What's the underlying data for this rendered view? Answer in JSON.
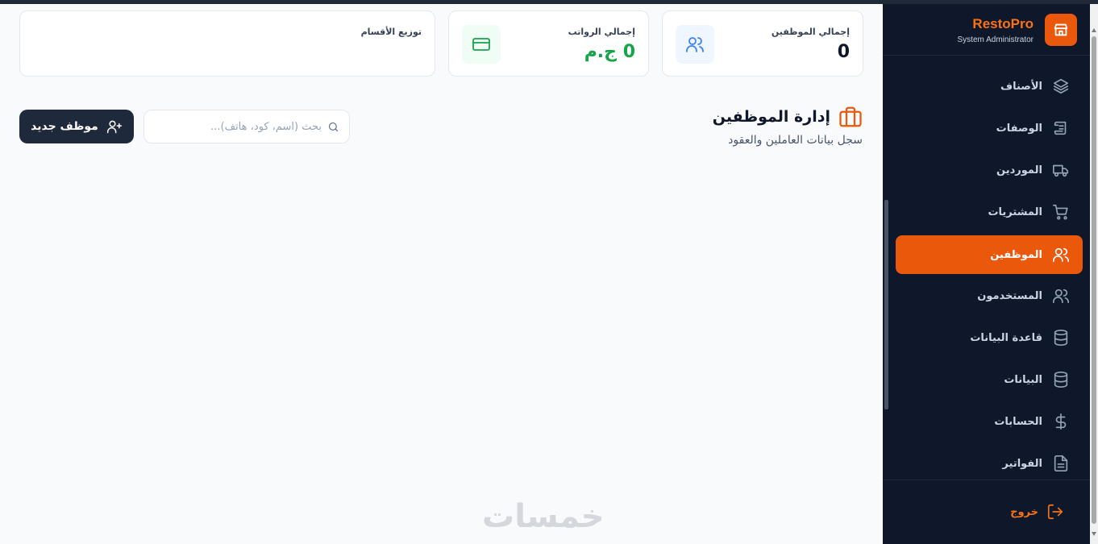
{
  "brand": {
    "name": "RestoPro",
    "subtitle": "System Administrator"
  },
  "nav": [
    {
      "label": "الأصناف",
      "icon": "layers-icon",
      "active": false
    },
    {
      "label": "الوصفات",
      "icon": "scroll-icon",
      "active": false
    },
    {
      "label": "الموردين",
      "icon": "truck-icon",
      "active": false
    },
    {
      "label": "المشتريات",
      "icon": "cart-icon",
      "active": false
    },
    {
      "label": "الموظفين",
      "icon": "users-icon",
      "active": true
    },
    {
      "label": "المستخدمون",
      "icon": "users-icon",
      "active": false
    },
    {
      "label": "قاعدة البيانات",
      "icon": "database-icon",
      "active": false
    },
    {
      "label": "البيانات",
      "icon": "database-icon",
      "active": false
    },
    {
      "label": "الحسابات",
      "icon": "dollar-icon",
      "active": false
    },
    {
      "label": "الفواتير",
      "icon": "file-icon",
      "active": false
    }
  ],
  "logout_label": "خروج",
  "stats": {
    "employees": {
      "title": "إجمالي الموظفين",
      "value": "0"
    },
    "salaries": {
      "title": "إجمالي الرواتب",
      "value": "0 ج.م"
    },
    "departments": {
      "title": "توزيع الأقسام"
    }
  },
  "page": {
    "title": "إدارة الموظفين",
    "subtitle": "سجل بيانات العاملين والعقود"
  },
  "search": {
    "placeholder": "بحث (اسم، كود، هاتف)...",
    "value": ""
  },
  "add_button": "موظف جديد",
  "watermark": "خمسات",
  "colors": {
    "accent": "#ea580c",
    "sidebar": "#0f172a",
    "success": "#16a34a",
    "info": "#3b82f6"
  }
}
